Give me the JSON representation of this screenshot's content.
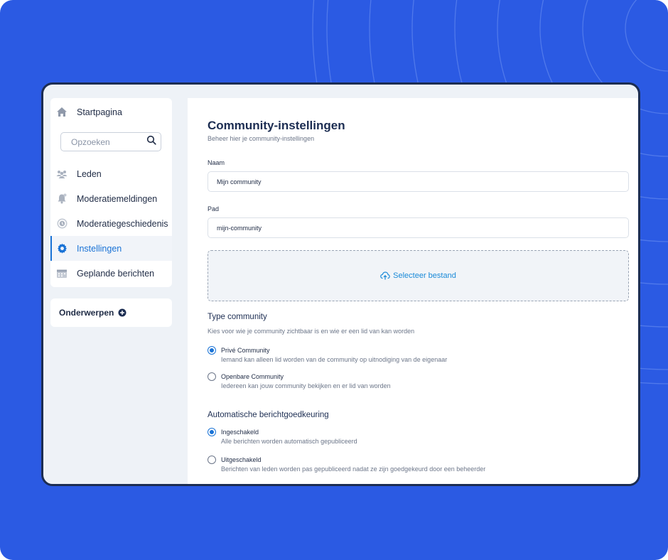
{
  "sidebar": {
    "home": {
      "label": "Startpagina",
      "icon": "home-icon"
    },
    "search": {
      "placeholder": "Opzoeken",
      "icon": "search-icon"
    },
    "items": [
      {
        "label": "Leden",
        "icon": "members-icon",
        "active": false
      },
      {
        "label": "Moderatiemeldingen",
        "icon": "bell-icon",
        "active": false
      },
      {
        "label": "Moderatiegeschiedenis",
        "icon": "history-icon",
        "active": false
      },
      {
        "label": "Instellingen",
        "icon": "gear-icon",
        "active": true
      },
      {
        "label": "Geplande berichten",
        "icon": "calendar-icon",
        "active": false
      }
    ],
    "topics": {
      "label": "Onderwerpen",
      "icon": "plus-circle-icon"
    }
  },
  "main": {
    "title": "Community-instellingen",
    "subtitle": "Beheer hier je community-instellingen",
    "name_label": "Naam",
    "name_value": "Mijn community",
    "path_label": "Pad",
    "path_value": "mijn-community",
    "upload_label": "Selecteer bestand",
    "type": {
      "title": "Type community",
      "description": "Kies voor wie je community zichtbaar is en wie er een lid van kan worden",
      "options": [
        {
          "label": "Privé Community",
          "description": "Iemand kan alleen lid worden van de community op uitnodiging van de eigenaar",
          "checked": true
        },
        {
          "label": "Openbare Community",
          "description": "Iedereen kan jouw community bekijken en er lid van worden",
          "checked": false
        }
      ]
    },
    "approval": {
      "title": "Automatische berichtgoedkeuring",
      "options": [
        {
          "label": "Ingeschakeld",
          "description": "Alle berichten worden automatisch gepubliceerd",
          "checked": true
        },
        {
          "label": "Uitgeschakeld",
          "description": "Berichten van leden worden pas gepubliceerd nadat ze zijn goedgekeurd door een beheerder",
          "checked": false
        }
      ]
    }
  },
  "colors": {
    "background": "#2b5ae3",
    "accent": "#1a73d6",
    "upload_text": "#1a8ad8",
    "heading": "#1c2d52"
  }
}
